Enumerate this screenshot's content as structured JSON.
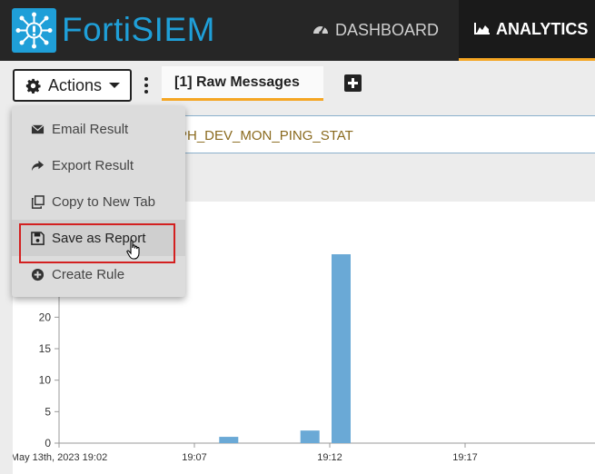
{
  "app": {
    "logo_icon": "network-hub-icon",
    "logo_text": "FortiSIEM",
    "brand_color": "#1f9fd8",
    "accent_color": "#f5a623"
  },
  "nav": {
    "dashboard_label": "DASHBOARD",
    "dashboard_icon": "gauge-icon",
    "analytics_label": "ANALYTICS",
    "analytics_icon": "area-chart-icon"
  },
  "toolbar": {
    "actions_label": "Actions",
    "tab_label": "[1] Raw Messages"
  },
  "query": {
    "text": "PH_DEV_MON_PING_STAT"
  },
  "menu": {
    "items": [
      {
        "label": "Email Result",
        "icon": "envelope-icon"
      },
      {
        "label": "Export Result",
        "icon": "share-arrow-icon"
      },
      {
        "label": "Copy to New Tab",
        "icon": "copy-icon"
      },
      {
        "label": "Save as Report",
        "icon": "floppy-disk-icon"
      },
      {
        "label": "Create Rule",
        "icon": "plus-circle-icon"
      }
    ],
    "highlighted_index": 3
  },
  "chart_data": {
    "type": "bar",
    "y_ticks": [
      "0",
      "5",
      "10",
      "15",
      "20"
    ],
    "x_ticks": [
      "May 13th, 2023 19:02",
      "19:07",
      "19:12",
      "19:17"
    ],
    "ylim": [
      0,
      30
    ],
    "bar_color": "#6aa9d6",
    "bars": [
      {
        "x": "19:08",
        "value": 1
      },
      {
        "x": "19:11",
        "value": 2
      },
      {
        "x": "19:12",
        "value": 30
      }
    ]
  }
}
